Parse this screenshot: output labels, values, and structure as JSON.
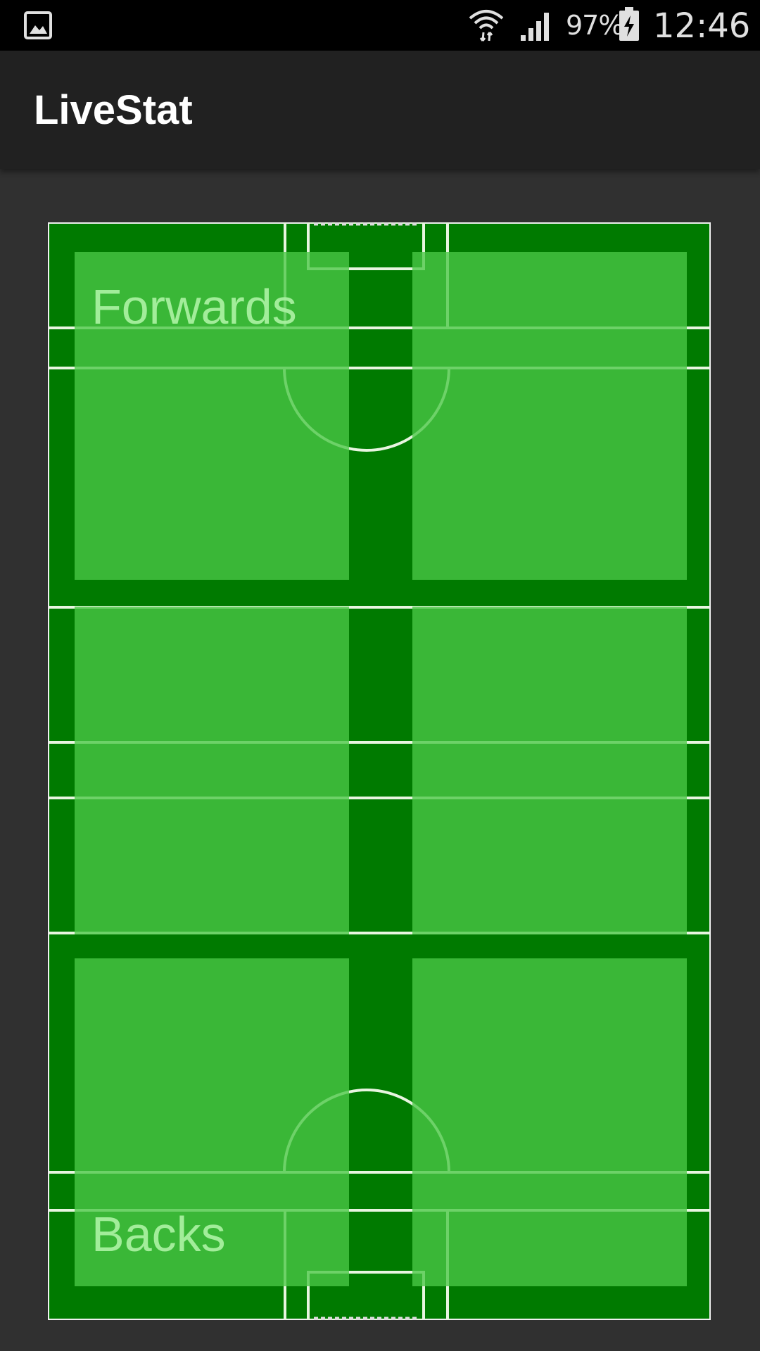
{
  "status_bar": {
    "notification_icon": "image-icon",
    "wifi_icon": "wifi-icon",
    "signal_icon": "cell-signal-icon",
    "battery_percent": "97%",
    "battery_icon": "battery-charging-icon",
    "time": "12:46"
  },
  "app_bar": {
    "title": "LiveStat"
  },
  "pitch": {
    "zones": {
      "forwards_label": "Forwards",
      "backs_label": "Backs"
    }
  },
  "colors": {
    "pitch_dark": "#007a00",
    "zone_light": "#4ac846",
    "line": "#e8f5e0",
    "background": "#303030",
    "app_bar": "#212121"
  }
}
